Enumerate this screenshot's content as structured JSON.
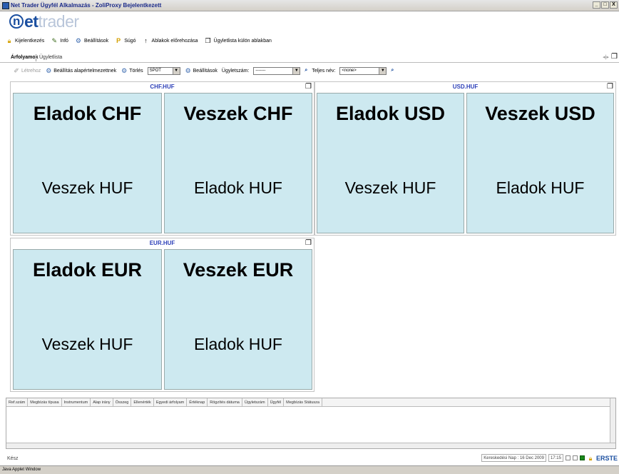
{
  "window": {
    "title": "Net Trader Ügyfél Alkalmazás - ZoliProxy Bejelentkezett",
    "buttons": [
      "_",
      "□",
      "X"
    ]
  },
  "logo": {
    "part1": "n",
    "part2": "et",
    "part3": "trader"
  },
  "menu": [
    {
      "label": "Kijelentkezés",
      "icon": "lock-icon"
    },
    {
      "label": "Infó",
      "icon": "info-icon"
    },
    {
      "label": "Beállítások",
      "icon": "settings-icon"
    },
    {
      "label": "Súgó",
      "icon": "help-icon"
    },
    {
      "label": "Ablakok előrehozása",
      "icon": "arrow-up-icon"
    },
    {
      "label": "Ügyletlista külön ablakban",
      "icon": "window-icon"
    }
  ],
  "tabs": {
    "active": "Árfolyamok",
    "second": "Ügyletlista"
  },
  "toolbar": {
    "create": "Létrehoz",
    "reset_defaults": "Beállítás alapértelmezettnek",
    "delete": "Törlés",
    "spot_value": "SPOT",
    "settings": "Beállítások",
    "ugyletszam_label": "Ügyletszám:",
    "ugyletszam_value": "-------",
    "teljes_nev_label": "Teljes név:",
    "teljes_nev_value": "<none>"
  },
  "panels": {
    "chf": {
      "title": "CHF.HUF",
      "sell_big": "Eladok CHF",
      "sell_small": "Veszek HUF",
      "buy_big": "Veszek CHF",
      "buy_small": "Eladok HUF"
    },
    "usd": {
      "title": "USD.HUF",
      "sell_big": "Eladok USD",
      "sell_small": "Veszek HUF",
      "buy_big": "Veszek USD",
      "buy_small": "Eladok HUF"
    },
    "eur": {
      "title": "EUR.HUF",
      "sell_big": "Eladok EUR",
      "sell_small": "Veszek HUF",
      "buy_big": "Veszek EUR",
      "buy_small": "Eladok HUF"
    }
  },
  "orders": {
    "columns": [
      "Ref.szám",
      "Megbízás típusa",
      "Instrumentum",
      "Alap irány",
      "Összeg",
      "Ellenérték",
      "Egyedi árfolyam",
      "Értéknap",
      "Rögzítés dátuma",
      "Ügyletszám",
      "Ügyfél",
      "Megbízás Státusza"
    ]
  },
  "status": {
    "left": "Kész",
    "trading_day": "Kereskedési Nap : 16 Dec 2009",
    "time": "17:15",
    "brand": "ERSTE"
  },
  "java_bar": "Java Applet Window"
}
